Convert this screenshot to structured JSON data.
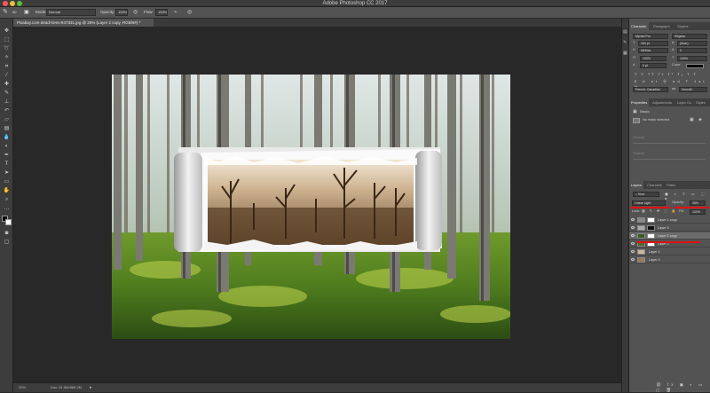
{
  "window": {
    "title": "Adobe Photoshop CC 2017",
    "traffic_lights": {
      "close": "#fc5b57",
      "minimize": "#e5bf3c",
      "zoom": "#57c038"
    }
  },
  "options_bar": {
    "brush_size": "50",
    "mode_label": "Mode:",
    "mode_value": "Normal",
    "opacity_label": "Opacity:",
    "opacity_value": "100%",
    "flow_label": "Flow:",
    "flow_value": "100%"
  },
  "document_tab": {
    "title": "Pixabay.com-dead-trees-947331.jpg @ 25% (Layer 2 copy, RGB/8#) *"
  },
  "status_bar": {
    "zoom": "25%",
    "doc_info": "Doc: 61.5M/869.2M"
  },
  "character_panel": {
    "tabs": [
      "Character",
      "Paragraph",
      "Glyphs"
    ],
    "font_family": "Myriad Pro",
    "font_style": "Regular",
    "font_size": "300 pt",
    "leading": "(Auto)",
    "kerning": "Metrics",
    "tracking": "0",
    "vertical_scale": "100%",
    "horizontal_scale": "100%",
    "baseline_shift": "0 pt",
    "color_label": "Color:",
    "color_value": "#000000",
    "language": "French: Canadian",
    "antialias": "Smooth"
  },
  "properties_panel": {
    "tabs": [
      "Properties",
      "Adjustments",
      "Layer Co",
      "Styles"
    ],
    "header": "Masks",
    "no_mask": "No mask selected",
    "density_label": "Density:",
    "feather_label": "Feather:"
  },
  "layers_panel": {
    "tabs": [
      "Layers",
      "Channels",
      "Paths"
    ],
    "filter_kind": "Kind",
    "blend_mode": "Linear Light",
    "opacity_label": "Opacity:",
    "opacity_value": "35%",
    "lock_label": "Lock:",
    "fill_label": "Fill:",
    "fill_value": "100%",
    "layers": [
      {
        "name": "Layer 1 copy",
        "selected": false
      },
      {
        "name": "Layer 3",
        "selected": false
      },
      {
        "name": "Layer 2 copy",
        "selected": true
      },
      {
        "name": "Layer 2",
        "selected": false
      },
      {
        "name": "Layer 1",
        "selected": false
      },
      {
        "name": "Layer 0",
        "selected": false
      }
    ]
  },
  "accent_colors": {
    "annotation_red": "#e01010",
    "panel_bg": "#535353",
    "canvas_bg": "#282828"
  }
}
